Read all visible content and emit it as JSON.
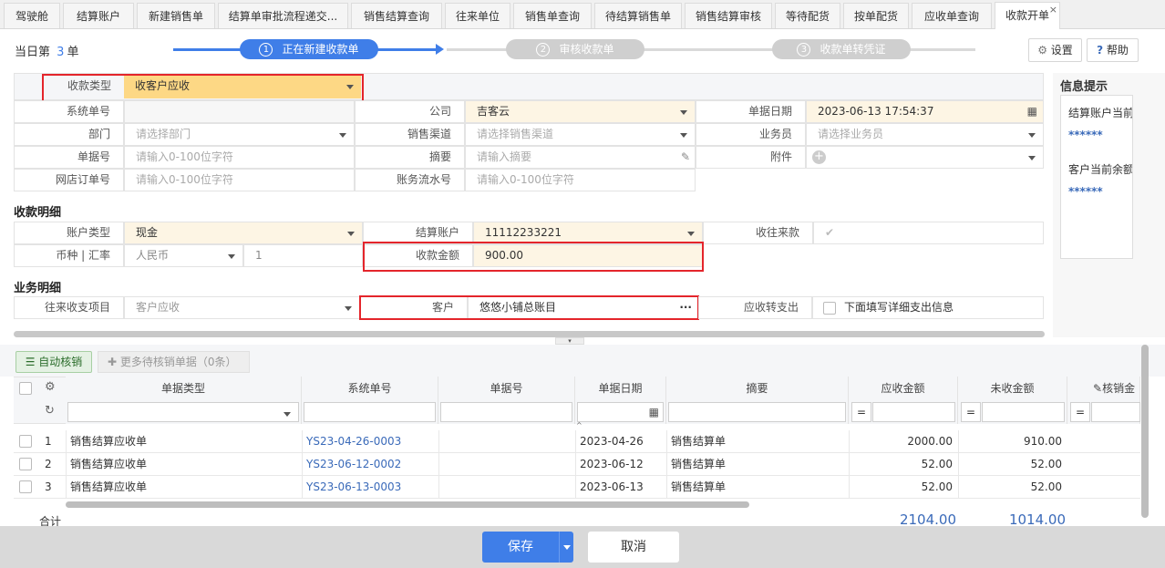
{
  "tabs": [
    "驾驶舱",
    "结算账户",
    "新建销售单",
    "结算单审批流程递交...",
    "销售结算查询",
    "往来单位",
    "销售单查询",
    "待结算销售单",
    "销售结算审核",
    "等待配货",
    "按单配货",
    "应收单查询",
    "收款开单"
  ],
  "tab_close": "×",
  "header": {
    "today_prefix": "当日第",
    "today_count": "3",
    "today_suffix": "单",
    "steps": [
      {
        "num": "1",
        "label": "正在新建收款单"
      },
      {
        "num": "2",
        "label": "审核收款单"
      },
      {
        "num": "3",
        "label": "收款单转凭证"
      }
    ],
    "settings_label": "设置",
    "help_label": "帮助",
    "help_icon_char": "?"
  },
  "form": {
    "receipt_type_label": "收款类型",
    "receipt_type_value": "收客户应收",
    "system_no_label": "系统单号",
    "company_label": "公司",
    "company_value": "吉客云",
    "bill_date_label": "单据日期",
    "bill_date_value": "2023-06-13 17:54:37",
    "dept_label": "部门",
    "dept_placeholder": "请选择部门",
    "channel_label": "销售渠道",
    "channel_placeholder": "请选择销售渠道",
    "salesman_label": "业务员",
    "salesman_placeholder": "请选择业务员",
    "bill_no_label": "单据号",
    "bill_no_placeholder": "请输入0-100位字符",
    "summary_label": "摘要",
    "summary_placeholder": "请输入摘要",
    "attachment_label": "附件",
    "shop_order_label": "网店订单号",
    "shop_order_placeholder": "请输入0-100位字符",
    "flow_no_label": "账务流水号",
    "flow_no_placeholder": "请输入0-100位字符"
  },
  "detail": {
    "section_title": "收款明细",
    "account_type_label": "账户类型",
    "account_type_value": "现金",
    "settle_account_label": "结算账户",
    "settle_account_value": "11112233221",
    "receive_ar_label": "收往来款",
    "currency_label": "币种 | 汇率",
    "currency_value": "人民币",
    "rate_value": "1",
    "amount_label": "收款金额",
    "amount_value": "900.00"
  },
  "business": {
    "section_title": "业务明细",
    "item_label": "往来收支项目",
    "item_value": "客户应收",
    "customer_label": "客户",
    "customer_value": "悠悠小铺总账目",
    "customer_more": "···",
    "ar_to_exp_label": "应收转支出",
    "fill_detail_label": "下面填写详细支出信息"
  },
  "info_panel": {
    "title": "信息提示",
    "line1": "结算账户当前",
    "mask1": "******",
    "line2": "客户当前余额",
    "mask2": "******"
  },
  "grid_toolbar": {
    "auto_writeoff_label": "自动核销",
    "more_label": "更多待核销单据",
    "more_count": "（0条）"
  },
  "grid": {
    "columns": [
      "单据类型",
      "系统单号",
      "单据号",
      "单据日期",
      "摘要",
      "应收金额",
      "未收金额",
      "核销金"
    ],
    "rows": [
      {
        "idx": "1",
        "type": "销售结算应收单",
        "sys_no": "YS23-04-26-0003",
        "bill_no": "",
        "date": "2023-04-26",
        "summary": "销售结算单",
        "receivable": "2000.00",
        "unreceived": "910.00"
      },
      {
        "idx": "2",
        "type": "销售结算应收单",
        "sys_no": "YS23-06-12-0002",
        "bill_no": "",
        "date": "2023-06-12",
        "summary": "销售结算单",
        "receivable": "52.00",
        "unreceived": "52.00"
      },
      {
        "idx": "3",
        "type": "销售结算应收单",
        "sys_no": "YS23-06-13-0003",
        "bill_no": "",
        "date": "2023-06-13",
        "summary": "销售结算单",
        "receivable": "52.00",
        "unreceived": "52.00"
      }
    ],
    "total_label": "合计",
    "total_receivable": "2104.00",
    "total_unreceived": "1014.00",
    "eq": "="
  },
  "footer": {
    "save_label": "保存",
    "cancel_label": "取消"
  },
  "colors": {
    "accent": "#3f7ee8",
    "required_bg": "#fdf5e4",
    "highlight_red": "#e4252b",
    "link": "#3a6ab9"
  }
}
